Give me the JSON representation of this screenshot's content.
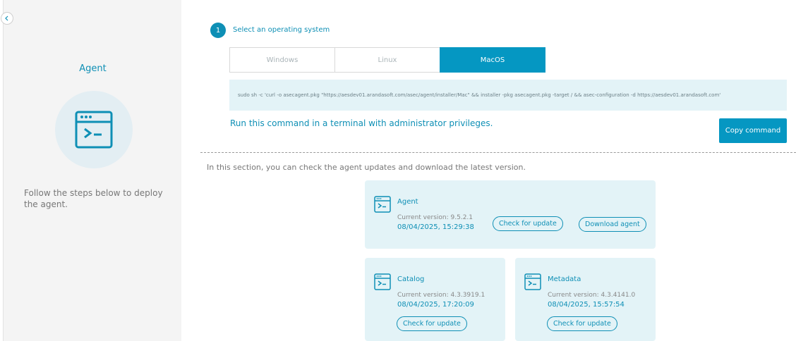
{
  "sidebar": {
    "title": "Agent",
    "description": "Follow the steps below to deploy the agent."
  },
  "step": {
    "number": "1",
    "label": "Select an operating system"
  },
  "os_tabs": [
    {
      "label": "Windows",
      "active": false
    },
    {
      "label": "Linux",
      "active": false
    },
    {
      "label": "MacOS",
      "active": true
    }
  ],
  "command": "sudo sh -c 'curl -o asecagent.pkg \"https://aesdev01.arandasoft.com/asec/agent/installer/Mac\" && installer -pkg asecagent.pkg -target / && asec-configuration -d https://aesdev01.arandasoft.com'",
  "run_instructions": "Run this command in a terminal with administrator privileges.",
  "copy_button": "Copy command",
  "updates_intro": "In this section, you can check the agent updates and download the latest version.",
  "cards": {
    "agent": {
      "title": "Agent",
      "version": "Current version: 9.5.2.1",
      "date": "08/04/2025, 15:29:38",
      "check_label": "Check for update",
      "download_label": "Download agent"
    },
    "catalog": {
      "title": "Catalog",
      "version": "Current version: 4.3.3919.1",
      "date": "08/04/2025, 17:20:09",
      "check_label": "Check for update"
    },
    "metadata": {
      "title": "Metadata",
      "version": "Current version: 4.3.4141.0",
      "date": "08/04/2025, 15:57:54",
      "check_label": "Check for update"
    }
  },
  "colors": {
    "accent": "#0597c2",
    "accent_text": "#0e8fb5",
    "card_bg": "#e3f3f7",
    "sidebar_bg": "#f4f4f4"
  },
  "icons": {
    "collapse": "chevron-left-icon",
    "terminal": "terminal-window-icon"
  }
}
